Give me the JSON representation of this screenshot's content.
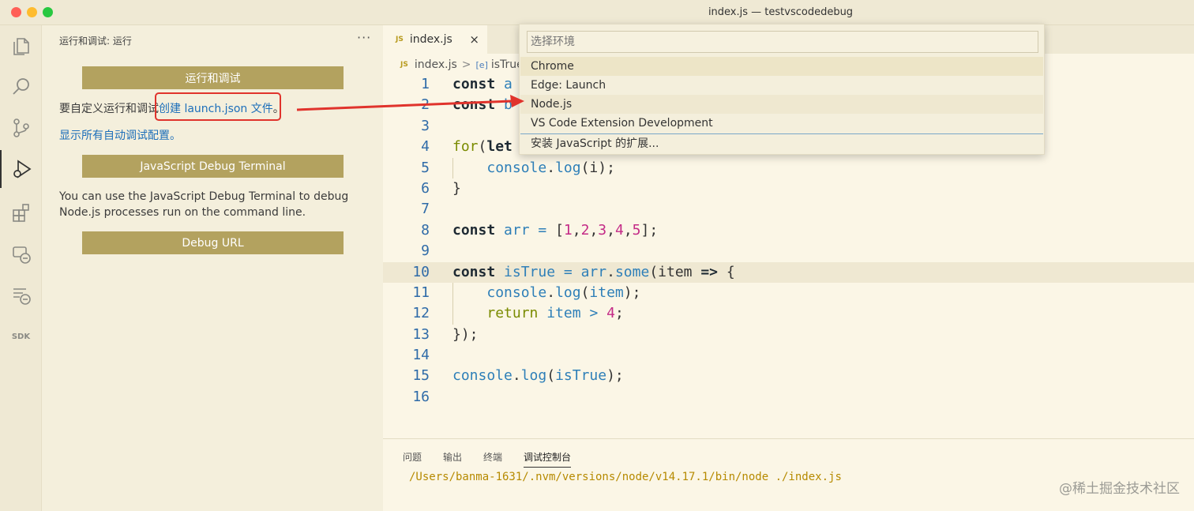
{
  "window": {
    "title": "index.js — testvscodedebug"
  },
  "activity_bar": {
    "icons": [
      "explorer-icon",
      "search-icon",
      "source-control-icon",
      "run-debug-icon",
      "extensions-icon",
      "remote-explorer-icon",
      "debug-tree-icon",
      "sdk-icon"
    ],
    "sdk_label": "SDK"
  },
  "sidebar": {
    "title": "运行和调试: 运行",
    "more": "···",
    "run_button": "运行和调试",
    "custom_text": "要自定义运行和调试",
    "create_link": "创建 launch.json 文件",
    "create_suffix": "。",
    "show_all_link": "显示所有自动调试配置。",
    "terminal_button": "JavaScript Debug Terminal",
    "terminal_desc_1": "You can use the JavaScript Debug Terminal to debug",
    "terminal_desc_2": "Node.js processes run on the command line.",
    "debug_url_button": "Debug URL"
  },
  "editor": {
    "tab": {
      "badge": "JS",
      "label": "index.js",
      "close": "×"
    },
    "breadcrumb": {
      "file": "index.js",
      "separator": ">",
      "symbol_icon": "[e]",
      "symbol": "isTrue"
    },
    "line_numbers": [
      "1",
      "2",
      "3",
      "4",
      "5",
      "6",
      "7",
      "8",
      "9",
      "10",
      "11",
      "12",
      "13",
      "14",
      "15",
      "16"
    ]
  },
  "quick_pick": {
    "placeholder": "选择环境",
    "items": [
      "Chrome",
      "Edge: Launch",
      "Node.js",
      "VS Code Extension Development"
    ],
    "extra": "安装 JavaScript 的扩展..."
  },
  "panel": {
    "tabs": [
      "问题",
      "输出",
      "终端",
      "调试控制台"
    ],
    "output": "/Users/banma-1631/.nvm/versions/node/v14.17.1/bin/node ./index.js"
  },
  "watermark": "@稀土掘金技术社区",
  "colors": {
    "accent_button": "#b3a25f",
    "callout": "#e0332c",
    "link": "#1d6fba"
  }
}
